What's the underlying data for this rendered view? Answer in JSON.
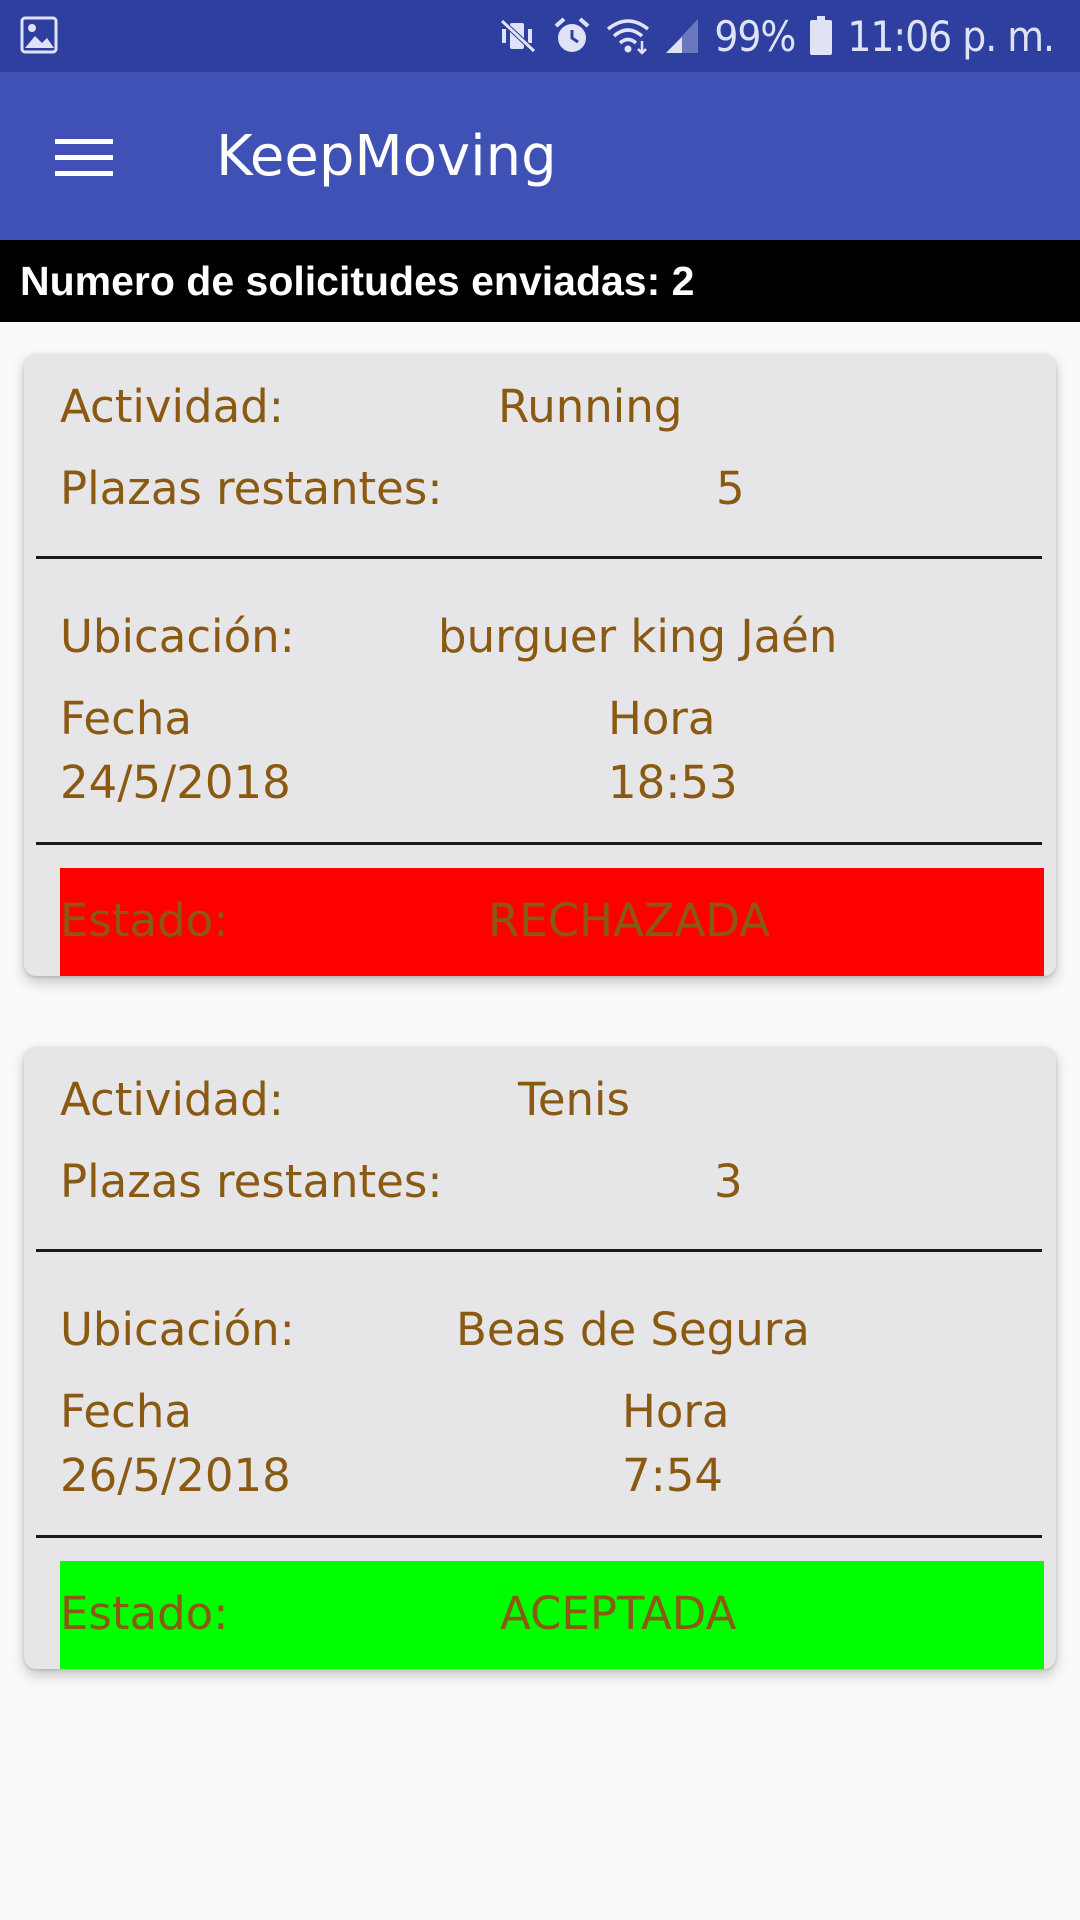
{
  "status_bar": {
    "battery": "99%",
    "time": "11:06 p. m.",
    "icons": [
      "image-icon",
      "mute-vibrate-icon",
      "alarm-icon",
      "wifi-icon",
      "signal-icon",
      "battery-icon"
    ]
  },
  "app_bar": {
    "title": "KeepMoving",
    "menu_icon": "hamburger-menu-icon"
  },
  "summary": {
    "text": "Numero de solicitudes enviadas: 2"
  },
  "requests": [
    {
      "actividad_label": "Actividad:",
      "actividad": "Running",
      "plazas_label": "Plazas restantes:",
      "plazas": "5",
      "ubicacion_label": "Ubicación:",
      "ubicacion": "burguer king Jaén",
      "fecha_label": "Fecha",
      "fecha": "24/5/2018",
      "hora_label": "Hora",
      "hora": "18:53",
      "estado_label": "Estado:",
      "estado": "RECHAZADA",
      "estado_color": "#ff0000"
    },
    {
      "actividad_label": "Actividad:",
      "actividad": "Tenis",
      "plazas_label": "Plazas restantes:",
      "plazas": "3",
      "ubicacion_label": "Ubicación:",
      "ubicacion": "Beas de Segura",
      "fecha_label": "Fecha",
      "fecha": "26/5/2018",
      "hora_label": "Hora",
      "hora": "7:54",
      "estado_label": "Estado:",
      "estado": "ACEPTADA",
      "estado_color": "#00ff00"
    }
  ],
  "colors": {
    "status_bar": "#2f3f9f",
    "app_bar": "#3f51b5",
    "card_text": "#8b5a12",
    "card_bg": "#e6e6e9"
  }
}
